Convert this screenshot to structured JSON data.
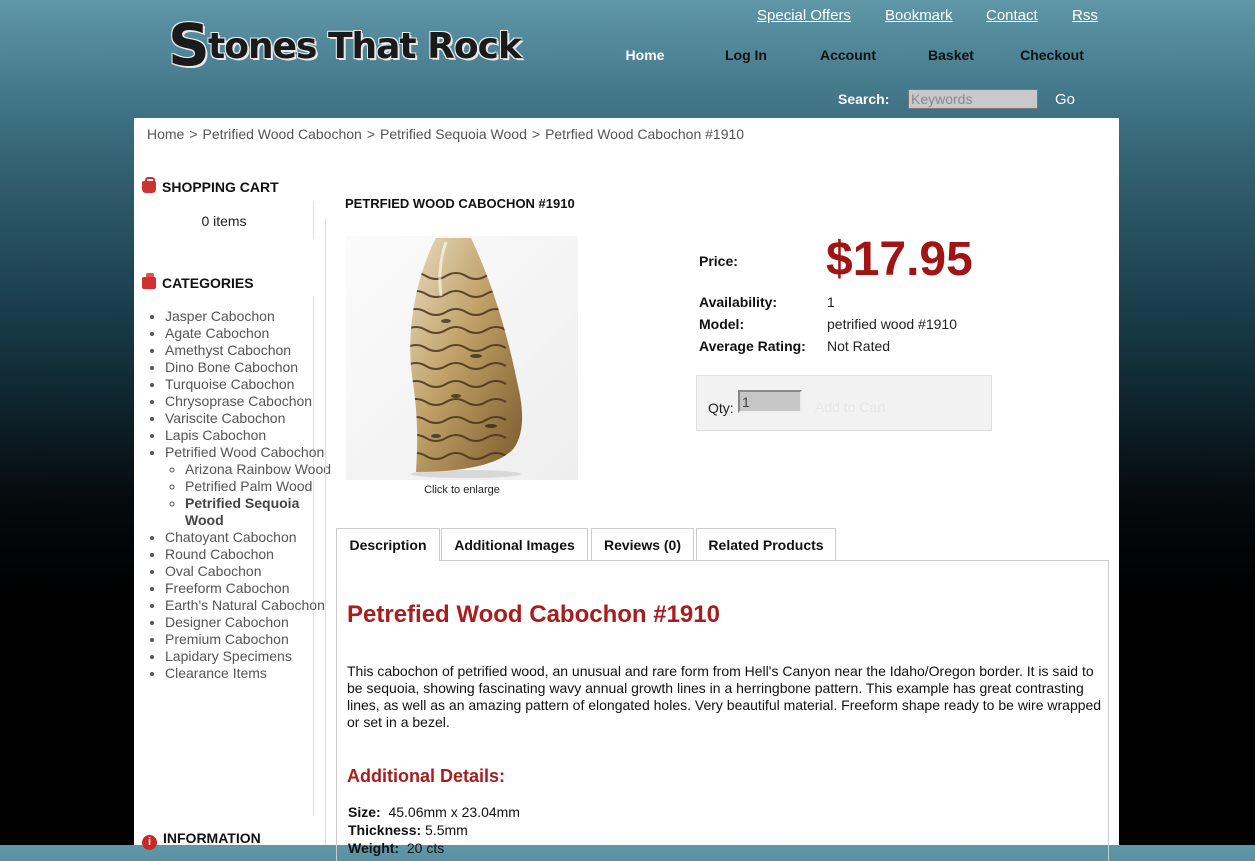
{
  "header": {
    "logo_initial": "S",
    "logo_rest": "tones That Rock",
    "top_links": [
      "Special Offers",
      "Bookmark",
      "Contact",
      "Rss"
    ],
    "nav": [
      "Home",
      "Log In",
      "Account",
      "Basket",
      "Checkout"
    ],
    "search_label": "Search:",
    "search_placeholder": "Keywords",
    "search_go": "Go"
  },
  "breadcrumb": [
    "Home",
    "Petrified Wood Cabochon",
    "Petrified Sequoia Wood",
    "Petrfied Wood Cabochon #1910"
  ],
  "breadcrumb_separator": ">",
  "sidebar": {
    "cart_heading": "SHOPPING CART",
    "cart_items": "0 items",
    "categories_heading": "CATEGORIES",
    "categories": [
      "Jasper Cabochon",
      "Agate Cabochon",
      "Amethyst Cabochon",
      "Dino Bone Cabochon",
      "Turquoise Cabochon",
      "Chrysoprase Cabochon",
      "Variscite Cabochon",
      "Lapis Cabochon",
      "Petrified Wood Cabochon"
    ],
    "subcategories": [
      "Arizona Rainbow Wood",
      "Petrified Palm Wood",
      "Petrified Sequoia Wood"
    ],
    "categories_after": [
      "Chatoyant Cabochon",
      "Round Cabochon",
      "Oval Cabochon",
      "Freeform Cabochon",
      "Earth's Natural Cabochon",
      "Designer Cabochon",
      "Premium Cabochon",
      "Lapidary Specimens",
      "Clearance Items"
    ],
    "info_heading": "INFORMATION"
  },
  "product": {
    "title": "PETRFIED WOOD CABOCHON #1910",
    "image_caption": "Click to enlarge",
    "price_label": "Price:",
    "price": "$17.95",
    "availability_label": "Availability:",
    "availability": "1",
    "model_label": "Model:",
    "model": "petrified wood #1910",
    "rating_label": "Average Rating:",
    "rating": "Not Rated",
    "qty_label": "Qty:",
    "qty_value": "1",
    "add_to_cart": "Add to Cart"
  },
  "tabs": [
    "Description",
    "Additional Images",
    "Reviews (0)",
    "Related Products"
  ],
  "description": {
    "heading": "Petrefied Wood Cabochon #1910",
    "body": "This cabochon of petrified wood, an unusual and rare form from Hell's Canyon near the Idaho/Oregon border. It is said to be sequoia, showing fascinating wavy annual growth lines in a herringbone pattern. This example has great contrasting lines, as well as an amazing pattern of elongated holes. Very beautiful material. Freeform shape ready to be wire wrapped or set in a bezel.",
    "details_heading": "Additional Details:",
    "size_label": "Size:",
    "size": "45.06mm x 23.04mm",
    "thickness_label": "Thickness:",
    "thickness": "5.5mm",
    "weight_label": "Weight:",
    "weight": "20 cts"
  },
  "colors": {
    "price": "#a01414",
    "heading_red": "#a81e1e",
    "panel": "#ffffff"
  }
}
